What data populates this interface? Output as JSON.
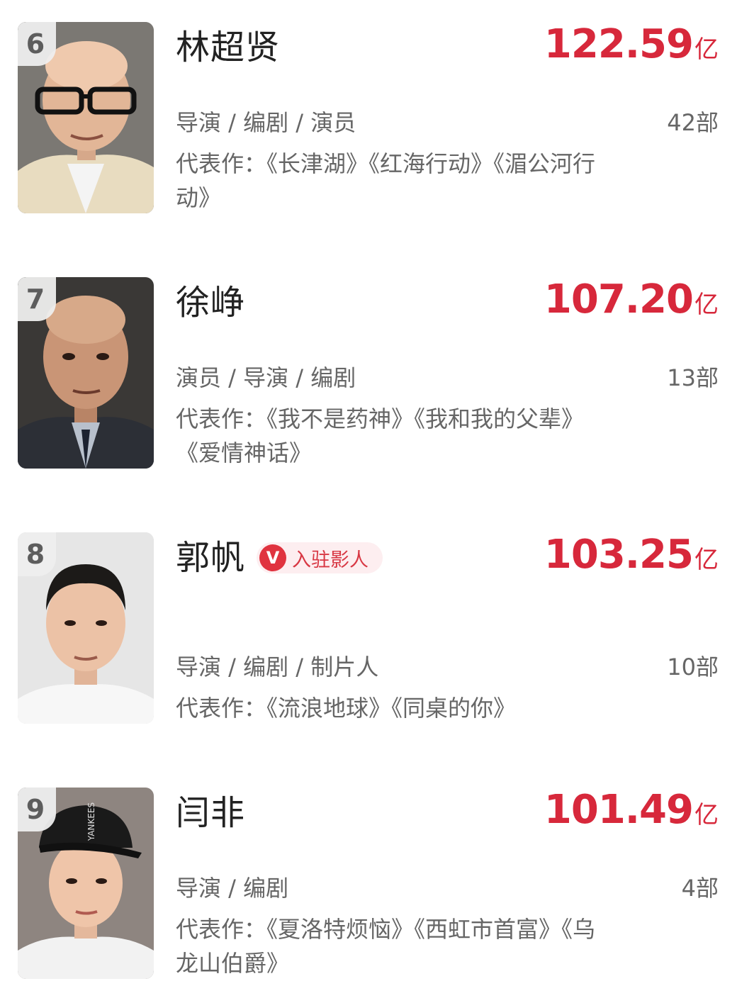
{
  "unit": "亿",
  "works_prefix": "代表作：",
  "entries": [
    {
      "rank": "6",
      "name": "林超贤",
      "box_office": "122.59",
      "roles": "导演 / 编剧 / 演员",
      "count": "42部",
      "works": "《长津湖》《红海行动》《湄公河行动》"
    },
    {
      "rank": "7",
      "name": "徐峥",
      "box_office": "107.20",
      "roles": "演员 / 导演 / 编剧",
      "count": "13部",
      "works": "《我不是药神》《我和我的父辈》《爱情神话》"
    },
    {
      "rank": "8",
      "name": "郭帆",
      "badge": "入驻影人",
      "badge_icon": "V",
      "box_office": "103.25",
      "roles": "导演 / 编剧 / 制片人",
      "count": "10部",
      "works": "《流浪地球》《同桌的你》"
    },
    {
      "rank": "9",
      "name": "闫非",
      "box_office": "101.49",
      "roles": "导演 / 编剧",
      "count": "4部",
      "works": "《夏洛特烦恼》《西虹市首富》《乌龙山伯爵》",
      "cap_text": "YANKEES"
    }
  ],
  "colors": {
    "accent": "#d7283b",
    "badge_bg": "#fdeef0",
    "rank_bg": "#eeeeee"
  }
}
